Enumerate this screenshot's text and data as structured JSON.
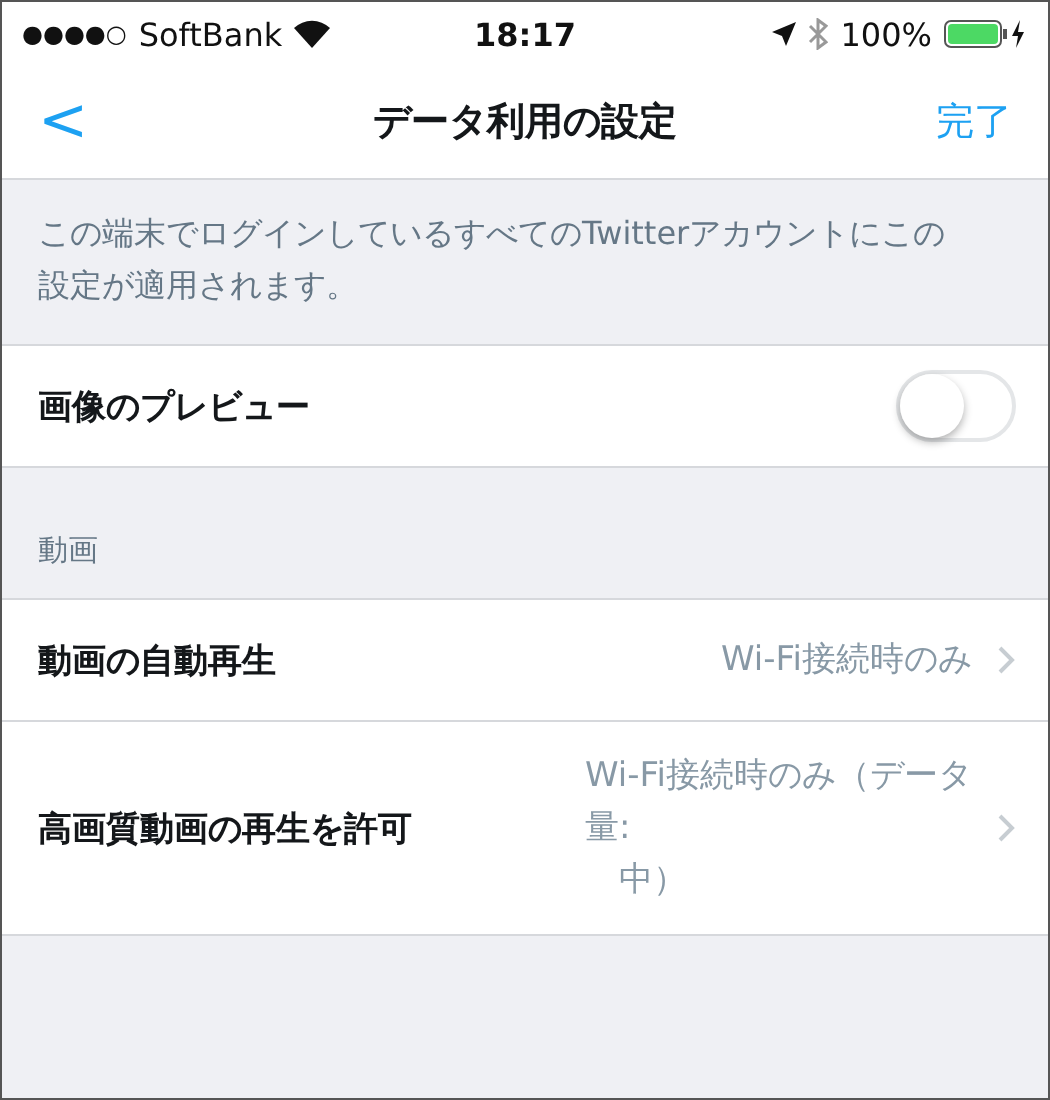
{
  "status_bar": {
    "signal_dots": "●●●●○",
    "carrier": "SoftBank",
    "time": "18:17",
    "battery": "100%"
  },
  "nav": {
    "back": "<",
    "title": "データ利用の設定",
    "done": "完了"
  },
  "description": "この端末でログインしているすべてのTwitterアカウントにこの設定が適用されます。",
  "sections": [
    {
      "rows": [
        {
          "kind": "toggle",
          "label": "画像のプレビュー",
          "on": false
        }
      ]
    },
    {
      "header": "動画",
      "rows": [
        {
          "kind": "link",
          "label": "動画の自動再生",
          "value_lines": [
            "Wi-Fi接続時のみ"
          ]
        },
        {
          "kind": "link",
          "label": "高画質動画の再生を許可",
          "value_lines": [
            "Wi-Fi接続時のみ（データ",
            "量:",
            "　中）"
          ]
        }
      ]
    }
  ]
}
